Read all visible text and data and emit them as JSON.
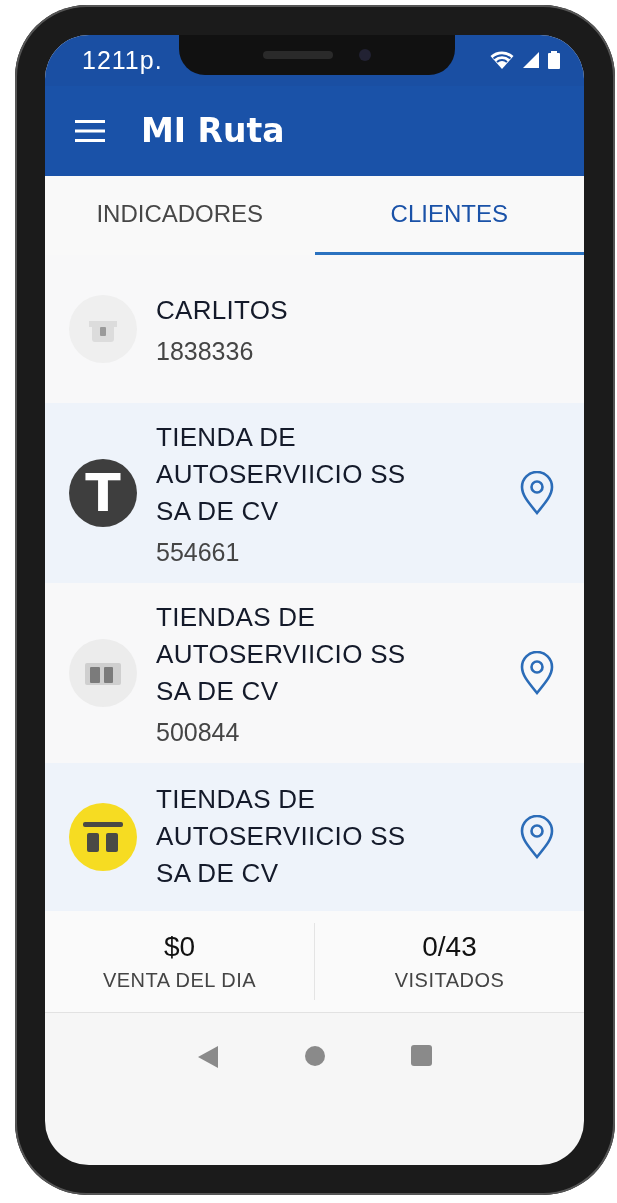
{
  "status_bar": {
    "time": "1211p."
  },
  "app_bar": {
    "title": "MI Ruta"
  },
  "tabs": [
    {
      "label": "INDICADORES",
      "selected": false
    },
    {
      "label": "CLIENTES",
      "selected": true
    }
  ],
  "clients": [
    {
      "name": "CARLITOS",
      "code": "1838336",
      "avatar": {
        "kind": "faded-store"
      },
      "has_location": false
    },
    {
      "name": "TIENDA DE AUTOSERVIICIO SS SA DE CV",
      "code": "554661",
      "avatar": {
        "kind": "letter",
        "letter": "T"
      },
      "has_location": true
    },
    {
      "name": "TIENDAS DE AUTOSERVIICIO SS SA DE CV",
      "code": "500844",
      "avatar": {
        "kind": "gray-store"
      },
      "has_location": true
    },
    {
      "name": "TIENDAS DE AUTOSERVIICIO SS SA DE CV",
      "avatar": {
        "kind": "yellow-store"
      },
      "has_location": true
    }
  ],
  "summary": [
    {
      "value": "$0",
      "label": "VENTA DEL DIA"
    },
    {
      "value": "0/43",
      "label": "VISITADOS"
    }
  ]
}
